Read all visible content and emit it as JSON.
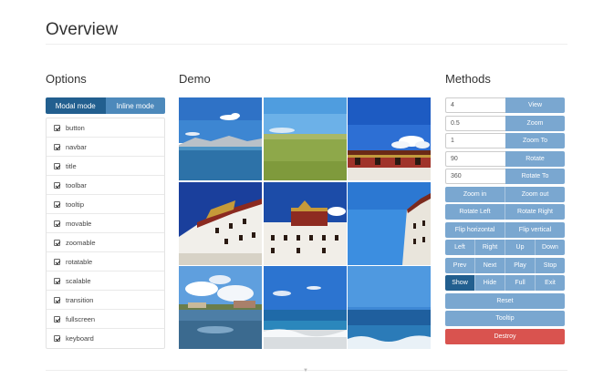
{
  "page": {
    "title": "Overview"
  },
  "sections": {
    "options": "Options",
    "demo": "Demo",
    "methods": "Methods"
  },
  "mode": {
    "modal": "Modal mode",
    "inline": "Inline mode",
    "selected": "Modal mode"
  },
  "options": [
    {
      "label": "button",
      "checked": true
    },
    {
      "label": "navbar",
      "checked": true
    },
    {
      "label": "title",
      "checked": true
    },
    {
      "label": "toolbar",
      "checked": true
    },
    {
      "label": "tooltip",
      "checked": true
    },
    {
      "label": "movable",
      "checked": true
    },
    {
      "label": "zoomable",
      "checked": true
    },
    {
      "label": "rotatable",
      "checked": true
    },
    {
      "label": "scalable",
      "checked": true
    },
    {
      "label": "transition",
      "checked": true
    },
    {
      "label": "fullscreen",
      "checked": true
    },
    {
      "label": "keyboard",
      "checked": true
    }
  ],
  "methods": {
    "inputs": [
      {
        "value": "4",
        "button": "View"
      },
      {
        "value": "0.5",
        "button": "Zoom"
      },
      {
        "value": "1",
        "button": "Zoom To"
      },
      {
        "value": "90",
        "button": "Rotate"
      },
      {
        "value": "360",
        "button": "Rotate To"
      }
    ],
    "zoom": [
      "Zoom in",
      "Zoom out"
    ],
    "rotate": [
      "Rotate Left",
      "Rotate Right"
    ],
    "flip": [
      "Flip horizontal",
      "Flip vertical"
    ],
    "move": [
      "Left",
      "Right",
      "Up",
      "Down"
    ],
    "play": [
      "Prev",
      "Next",
      "Play",
      "Stop"
    ],
    "show": [
      "Show",
      "Hide",
      "Full",
      "Exit"
    ],
    "reset": "Reset",
    "tooltip": "Tooltip",
    "destroy": "Destroy"
  },
  "colors": {
    "primary_dark": "#225f8f",
    "primary": "#4d89bb",
    "primary_light": "#7aa7d0",
    "danger": "#d9534f"
  },
  "gallery": [
    {
      "subject": "lake-mountains"
    },
    {
      "subject": "grassland"
    },
    {
      "subject": "palace-roof"
    },
    {
      "subject": "palace-left"
    },
    {
      "subject": "palace-center"
    },
    {
      "subject": "palace-right"
    },
    {
      "subject": "river-village"
    },
    {
      "subject": "lake-shore"
    },
    {
      "subject": "lake-waves"
    }
  ]
}
